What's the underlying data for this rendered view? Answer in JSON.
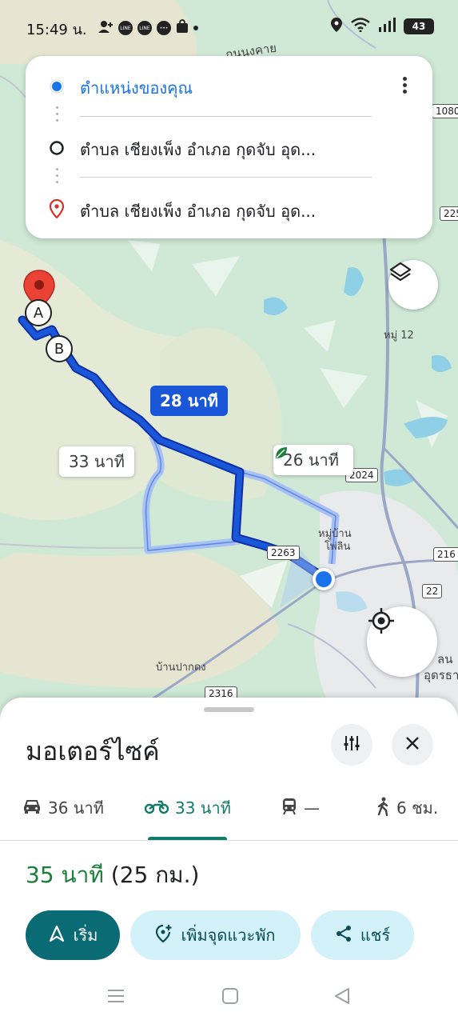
{
  "status_bar": {
    "time": "15:49 น.",
    "battery": "43"
  },
  "directions": {
    "origin": "ตำแหน่งของคุณ",
    "stop": "ตำบล เชียงเพ็ง อำเภอ กุดจับ อุด...",
    "destination": "ตำบล เชียงเพ็ง อำเภอ กุดจับ อุด..."
  },
  "map": {
    "route_labels": {
      "main": "28 นาที",
      "alt_left": "33 นาที",
      "alt_right": "26 นาที"
    },
    "place_labels": {
      "village_1": "หมู่ 12",
      "village_2_line1": "หมู่บ้าน",
      "village_2_line2": "โพ่ลิน",
      "village_3": "บ้านปากดง",
      "top_road": "ถนนงคาย",
      "city_1": "ลน",
      "city_2": "อุดรธา"
    },
    "road_shields": {
      "r1080": "1080",
      "r225": "225",
      "r2024": "2024",
      "r2263": "2263",
      "r216": "216",
      "r22": "22",
      "r2316": "2316"
    },
    "markers": {
      "a": "A",
      "b": "B"
    }
  },
  "sheet": {
    "title": "มอเตอร์ไซค์",
    "modes": [
      {
        "name": "car",
        "label": "36 นาที"
      },
      {
        "name": "motorcycle",
        "label": "33 นาที"
      },
      {
        "name": "transit",
        "label": "—"
      },
      {
        "name": "walk",
        "label": "6 ชม."
      }
    ],
    "duration": "35 นาที",
    "distance": "(25 กม.)",
    "buttons": {
      "start": "เริ่ม",
      "add_stop": "เพิ่มจุดแวะพัก",
      "share": "แชร์"
    }
  },
  "colors": {
    "route_main": "#1a57d8",
    "route_alt": "#a8c1f5",
    "accent_green": "#188038",
    "primary_button": "#0b6b75"
  }
}
